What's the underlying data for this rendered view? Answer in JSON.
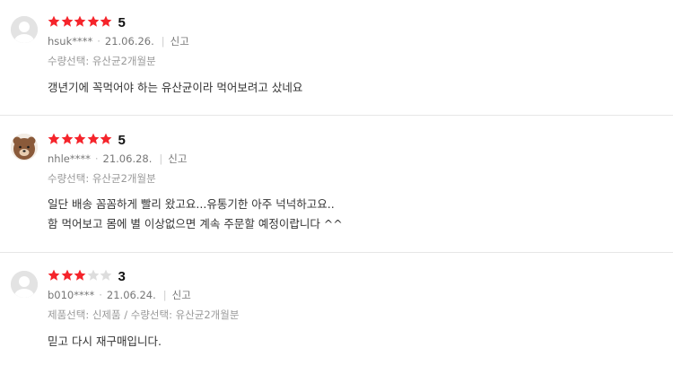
{
  "reviews": [
    {
      "rating_value": 5,
      "score": "5",
      "user": "hsuk****",
      "date": "21.06.26.",
      "report": "신고",
      "option": "수량선택: 유산균2개월분",
      "lines": [
        "갱년기에 꼭먹어야 하는 유산균이라 먹어보려고 샀네요"
      ],
      "avatar": "default-avatar"
    },
    {
      "rating_value": 5,
      "score": "5",
      "user": "nhle****",
      "date": "21.06.28.",
      "report": "신고",
      "option": "수량선택: 유산균2개월분",
      "lines": [
        "일단 배송 꼼꼼하게 빨리 왔고요...유통기한 아주 넉넉하고요..",
        "함 먹어보고 몸에 별 이상없으면 계속 주문할 예정이랍니다 ^^"
      ],
      "avatar": "bear-avatar"
    },
    {
      "rating_value": 3,
      "score": "3",
      "user": "b010****",
      "date": "21.06.24.",
      "report": "신고",
      "option": "제품선택: 신제품 / 수량선택: 유산균2개월분",
      "lines": [
        "믿고 다시 재구매입니다."
      ],
      "avatar": "default-avatar"
    }
  ],
  "colors": {
    "star_on": "#f5242b",
    "star_off": "#dddddd",
    "avatar_bg": "#e3e3e3",
    "bear": "#8a5a3a"
  }
}
